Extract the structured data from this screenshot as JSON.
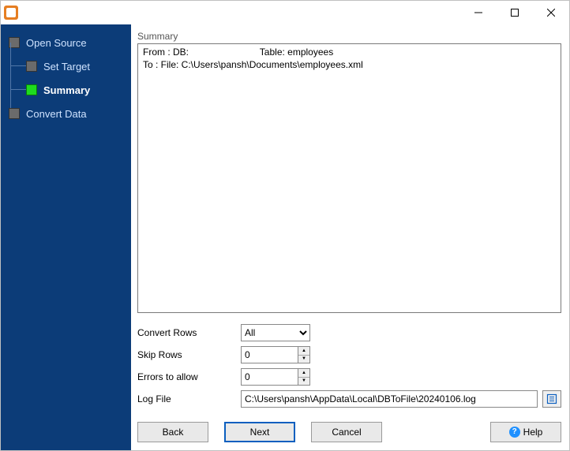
{
  "titlebar": {
    "title": ""
  },
  "sidebar": {
    "items": [
      {
        "label": "Open Source",
        "level": "root",
        "active": false
      },
      {
        "label": "Set Target",
        "level": "child",
        "active": false
      },
      {
        "label": "Summary",
        "level": "child",
        "active": true
      },
      {
        "label": "Convert Data",
        "level": "root",
        "active": false
      }
    ]
  },
  "main": {
    "summary_title": "Summary",
    "summary_lines": "From : DB:                           Table: employees\nTo : File: C:\\Users\\pansh\\Documents\\employees.xml",
    "convert_rows_label": "Convert Rows",
    "convert_rows_value": "All",
    "skip_rows_label": "Skip Rows",
    "skip_rows_value": "0",
    "errors_label": "Errors to allow",
    "errors_value": "0",
    "logfile_label": "Log File",
    "logfile_value": "C:\\Users\\pansh\\AppData\\Local\\DBToFile\\20240106.log"
  },
  "buttons": {
    "back": "Back",
    "next": "Next",
    "cancel": "Cancel",
    "help": "Help"
  }
}
